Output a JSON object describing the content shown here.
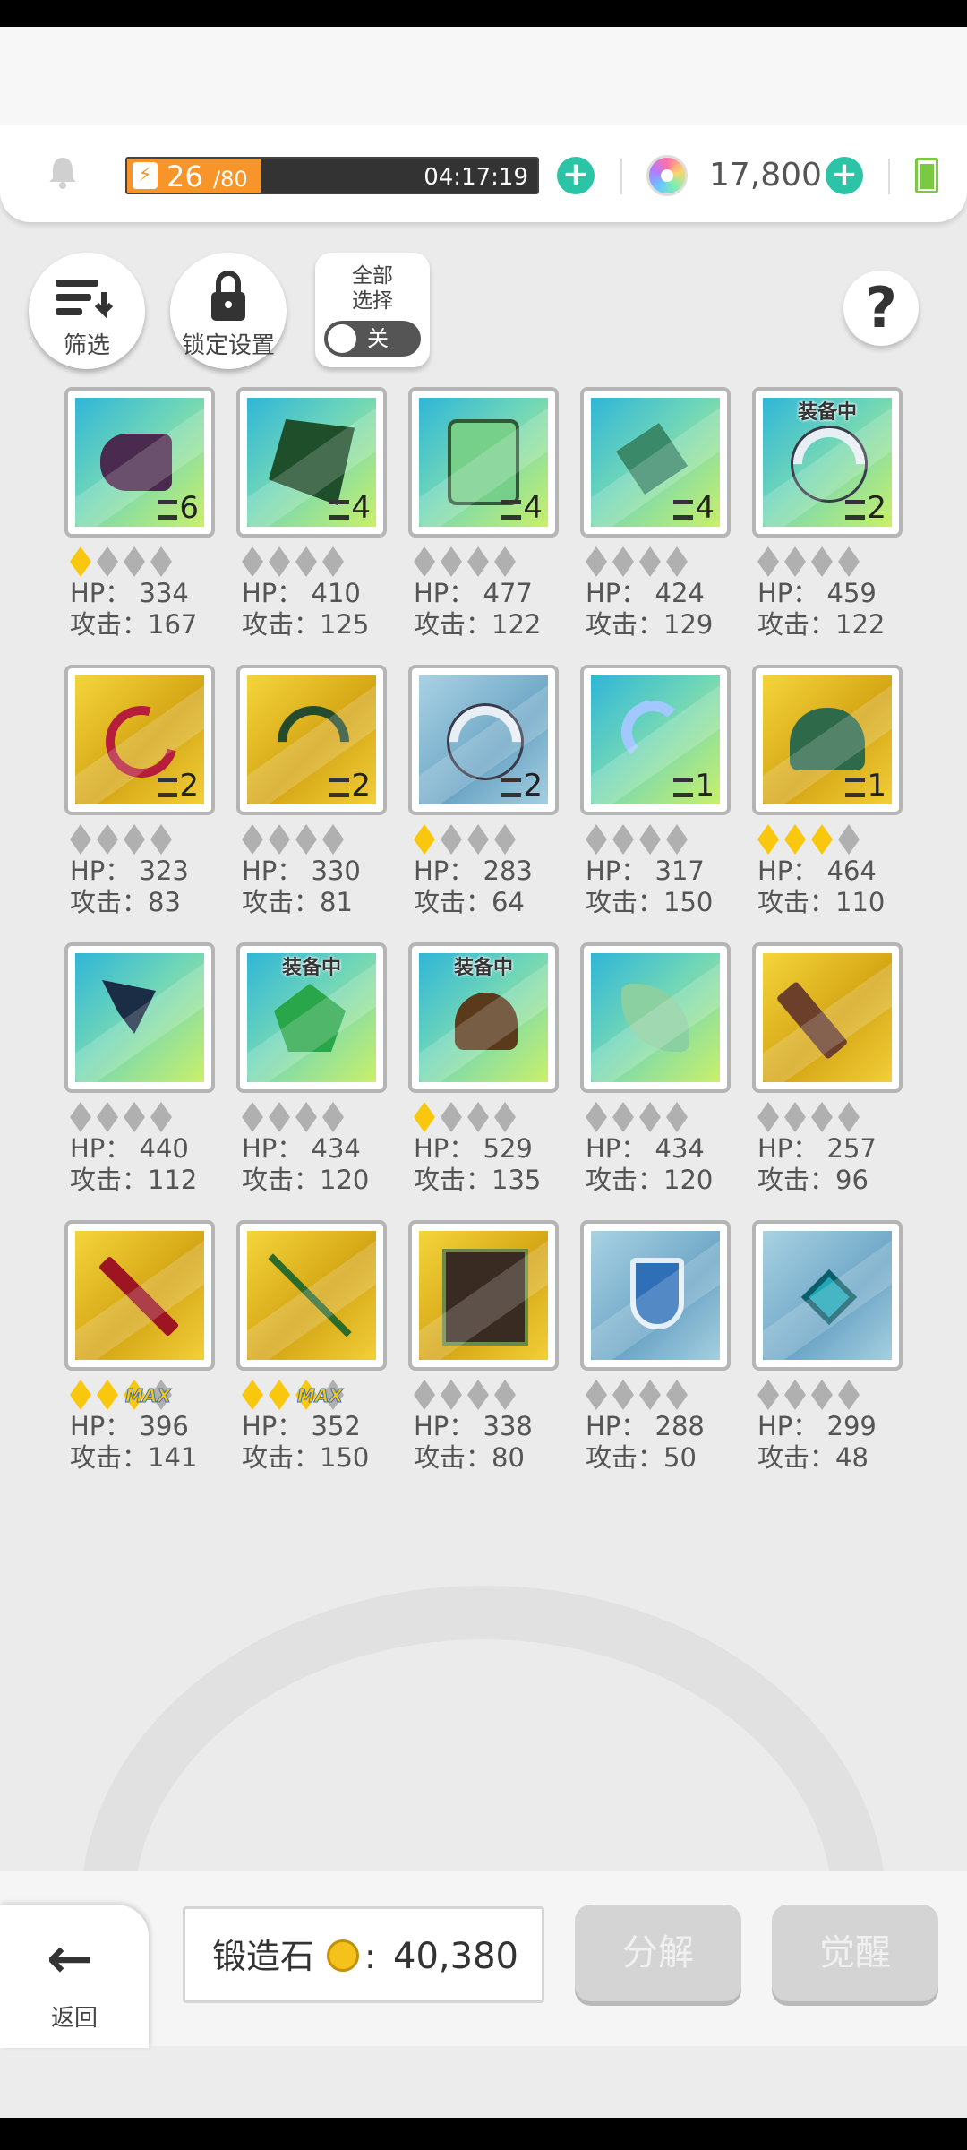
{
  "header": {
    "energy": {
      "current": "26",
      "max": "/80",
      "timer": "04:17:19",
      "fill_fraction": 0.325
    },
    "gems": {
      "count": "17,800"
    }
  },
  "controls": {
    "filter_label": "筛选",
    "lock_label": "锁定设置",
    "select_all_label": "全部\n选择",
    "select_all_toggle": "关",
    "help_label": "?"
  },
  "items": [
    {
      "tile": "green",
      "shape": "gauntlet",
      "count": "6",
      "equipped": "",
      "stars": 1,
      "max": false,
      "hp": "HP： 334",
      "atk": "攻击：167"
    },
    {
      "tile": "green",
      "shape": "cape",
      "count": "4",
      "equipped": "",
      "stars": 0,
      "max": false,
      "hp": "HP： 410",
      "atk": "攻击：125"
    },
    {
      "tile": "green",
      "shape": "slime",
      "count": "4",
      "equipped": "",
      "stars": 0,
      "max": false,
      "hp": "HP： 477",
      "atk": "攻击：122"
    },
    {
      "tile": "green",
      "shape": "claw",
      "count": "4",
      "equipped": "",
      "stars": 0,
      "max": false,
      "hp": "HP： 424",
      "atk": "攻击：129"
    },
    {
      "tile": "green",
      "shape": "bow2",
      "count": "2",
      "equipped": "装备中",
      "stars": 0,
      "max": false,
      "hp": "HP： 459",
      "atk": "攻击：122"
    },
    {
      "tile": "gold",
      "shape": "crossbow",
      "count": "2",
      "equipped": "",
      "stars": 0,
      "max": false,
      "hp": "HP： 323",
      "atk": "攻击：83"
    },
    {
      "tile": "gold",
      "shape": "bow",
      "count": "2",
      "equipped": "",
      "stars": 0,
      "max": false,
      "hp": "HP： 330",
      "atk": "攻击：81"
    },
    {
      "tile": "blue",
      "shape": "bow2",
      "count": "2",
      "equipped": "",
      "stars": 1,
      "max": false,
      "hp": "HP： 283",
      "atk": "攻击：64"
    },
    {
      "tile": "green",
      "shape": "hook",
      "count": "1",
      "equipped": "",
      "stars": 0,
      "max": false,
      "hp": "HP： 317",
      "atk": "攻击：150"
    },
    {
      "tile": "gold",
      "shape": "helm",
      "count": "1",
      "equipped": "",
      "stars": 3,
      "max": false,
      "hp": "HP： 464",
      "atk": "攻击：110"
    },
    {
      "tile": "green",
      "shape": "axe",
      "count": "",
      "equipped": "",
      "stars": 0,
      "max": false,
      "hp": "HP： 440",
      "atk": "攻击：112"
    },
    {
      "tile": "green",
      "shape": "charm",
      "count": "",
      "equipped": "装备中",
      "stars": 0,
      "max": false,
      "hp": "HP： 434",
      "atk": "攻击：120"
    },
    {
      "tile": "green",
      "shape": "bell",
      "count": "",
      "equipped": "装备中",
      "stars": 1,
      "max": false,
      "hp": "HP： 529",
      "atk": "攻击：135"
    },
    {
      "tile": "green",
      "shape": "leaf",
      "count": "",
      "equipped": "",
      "stars": 0,
      "max": false,
      "hp": "HP： 434",
      "atk": "攻击：120"
    },
    {
      "tile": "gold",
      "shape": "blade",
      "count": "",
      "equipped": "",
      "stars": 0,
      "max": false,
      "hp": "HP： 257",
      "atk": "攻击：96"
    },
    {
      "tile": "gold",
      "shape": "sword",
      "count": "",
      "equipped": "",
      "stars": 3,
      "max": true,
      "hp": "HP： 396",
      "atk": "攻击：141"
    },
    {
      "tile": "gold",
      "shape": "spear",
      "count": "",
      "equipped": "",
      "stars": 3,
      "max": true,
      "hp": "HP： 352",
      "atk": "攻击：150"
    },
    {
      "tile": "gold",
      "shape": "book",
      "count": "",
      "equipped": "",
      "stars": 0,
      "max": false,
      "hp": "HP： 338",
      "atk": "攻击：80"
    },
    {
      "tile": "blue",
      "shape": "shield",
      "count": "",
      "equipped": "",
      "stars": 0,
      "max": false,
      "hp": "HP： 288",
      "atk": "攻击：50"
    },
    {
      "tile": "blue",
      "shape": "gem",
      "count": "",
      "equipped": "",
      "stars": 0,
      "max": false,
      "hp": "HP： 299",
      "atk": "攻击：48"
    }
  ],
  "max_label": "MAX",
  "footer": {
    "back_label": "返回",
    "forge_label": "锻造石",
    "forge_colon": ":",
    "forge_value": "40,380",
    "decompose_label": "分解",
    "awaken_label": "觉醒"
  }
}
